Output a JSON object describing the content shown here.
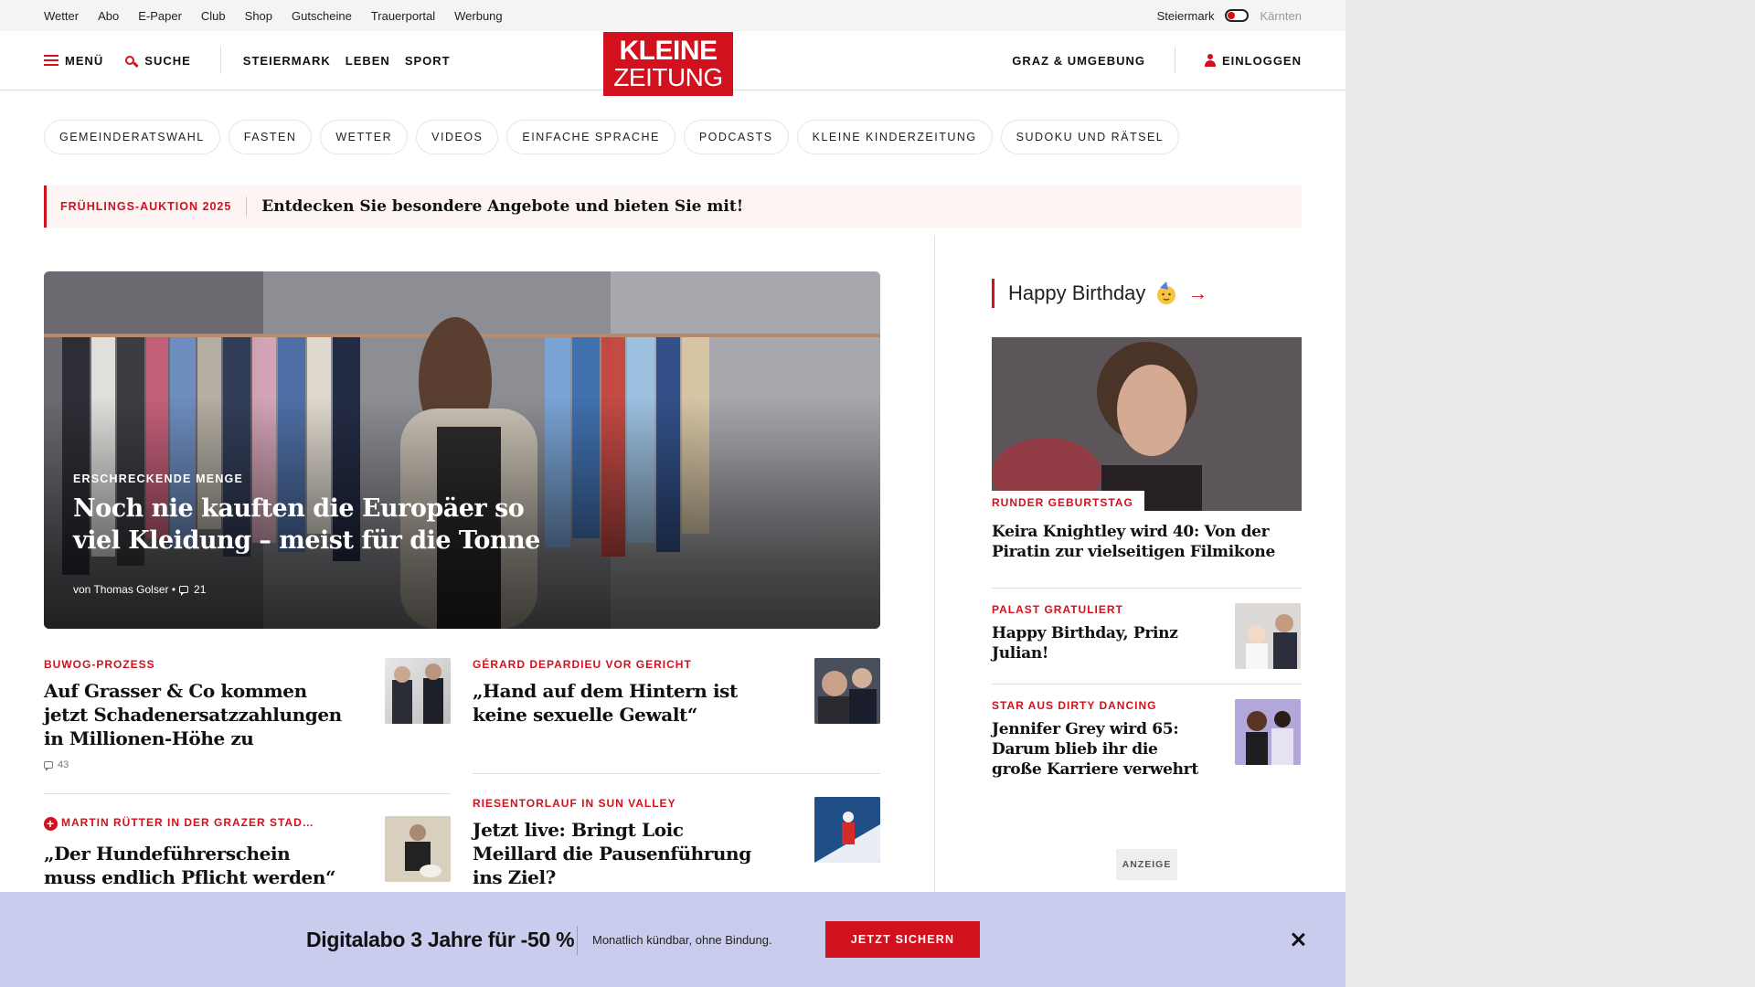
{
  "topbar": {
    "links": [
      "Wetter",
      "Abo",
      "E-Paper",
      "Club",
      "Shop",
      "Gutscheine",
      "Trauerportal",
      "Werbung"
    ],
    "region_active": "Steiermark",
    "region_inactive": "Kärnten"
  },
  "header": {
    "menu": "MENÜ",
    "search": "SUCHE",
    "nav": [
      "STEIERMARK",
      "LEBEN",
      "SPORT"
    ],
    "logo_line1": "KLEINE",
    "logo_line2": "ZEITUNG",
    "region_nav": "GRAZ & UMGEBUNG",
    "login": "EINLOGGEN"
  },
  "pills": [
    "GEMEINDERATSWAHL",
    "FASTEN",
    "WETTER",
    "VIDEOS",
    "EINFACHE SPRACHE",
    "PODCASTS",
    "KLEINE KINDERZEITUNG",
    "SUDOKU UND RÄTSEL"
  ],
  "promo": {
    "tag": "FRÜHLINGS-AUKTION 2025",
    "text": "Entdecken Sie besondere Angebote und bieten Sie mit!"
  },
  "hero": {
    "kicker": "ERSCHRECKENDE MENGE",
    "title": "Noch nie kauften die Europäer so viel Kleidung – meist für die Tonne",
    "author": "von Thomas Golser •",
    "comments": "21"
  },
  "articles": [
    {
      "kicker": "BUWOG-PROZESS",
      "title": "Auf Grasser & Co kommen jetzt Schadenersatzzahlungen in Millionen-Höhe zu",
      "comments": "43"
    },
    {
      "kicker": "GÉRARD DEPARDIEU VOR GERICHT",
      "title": "„Hand auf dem Hintern ist keine sexuelle Gewalt“"
    },
    {
      "kicker": "MARTIN RÜTTER IN DER GRAZER STAD…",
      "title": "„Der Hundeführerschein muss endlich Pflicht werden“"
    },
    {
      "kicker": "RIESENTORLAUF IN SUN VALLEY",
      "title": "Jetzt live: Bringt Loic Meillard die Pausenführung ins Ziel?"
    }
  ],
  "sidebar": {
    "heading": "Happy Birthday",
    "arrow": "→",
    "lead": {
      "kicker": "RUNDER GEBURTSTAG",
      "title": "Keira Knightley wird 40: Von der Piratin zur vielseitigen Filmikone"
    },
    "items": [
      {
        "kicker": "PALAST GRATULIERT",
        "title": "Happy Birthday, Prinz Julian!"
      },
      {
        "kicker": "STAR AUS DIRTY DANCING",
        "title": "Jennifer Grey wird 65: Darum blieb ihr die große Karriere verwehrt"
      }
    ],
    "ad_label": "ANZEIGE"
  },
  "banner": {
    "headline": "Digitalabo 3 Jahre für -50 %",
    "subtext": "Monatlich kündbar, ohne Bindung.",
    "cta": "JETZT SICHERN"
  },
  "colors": {
    "accent": "#d1111d",
    "banner_bg": "#c9ccec",
    "promo_bg": "#fdf4f4"
  }
}
